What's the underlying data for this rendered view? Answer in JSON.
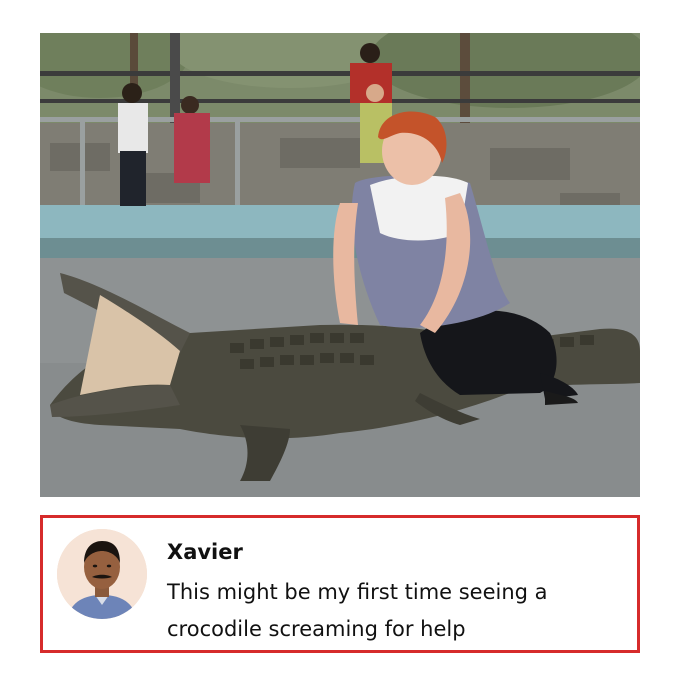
{
  "photo": {
    "alt_subject": "woman-sitting-on-crocodile"
  },
  "comment": {
    "author": "Xavier",
    "text": "This might be my first time seeing a crocodile screaming for help",
    "border_color": "#d62b2b"
  }
}
